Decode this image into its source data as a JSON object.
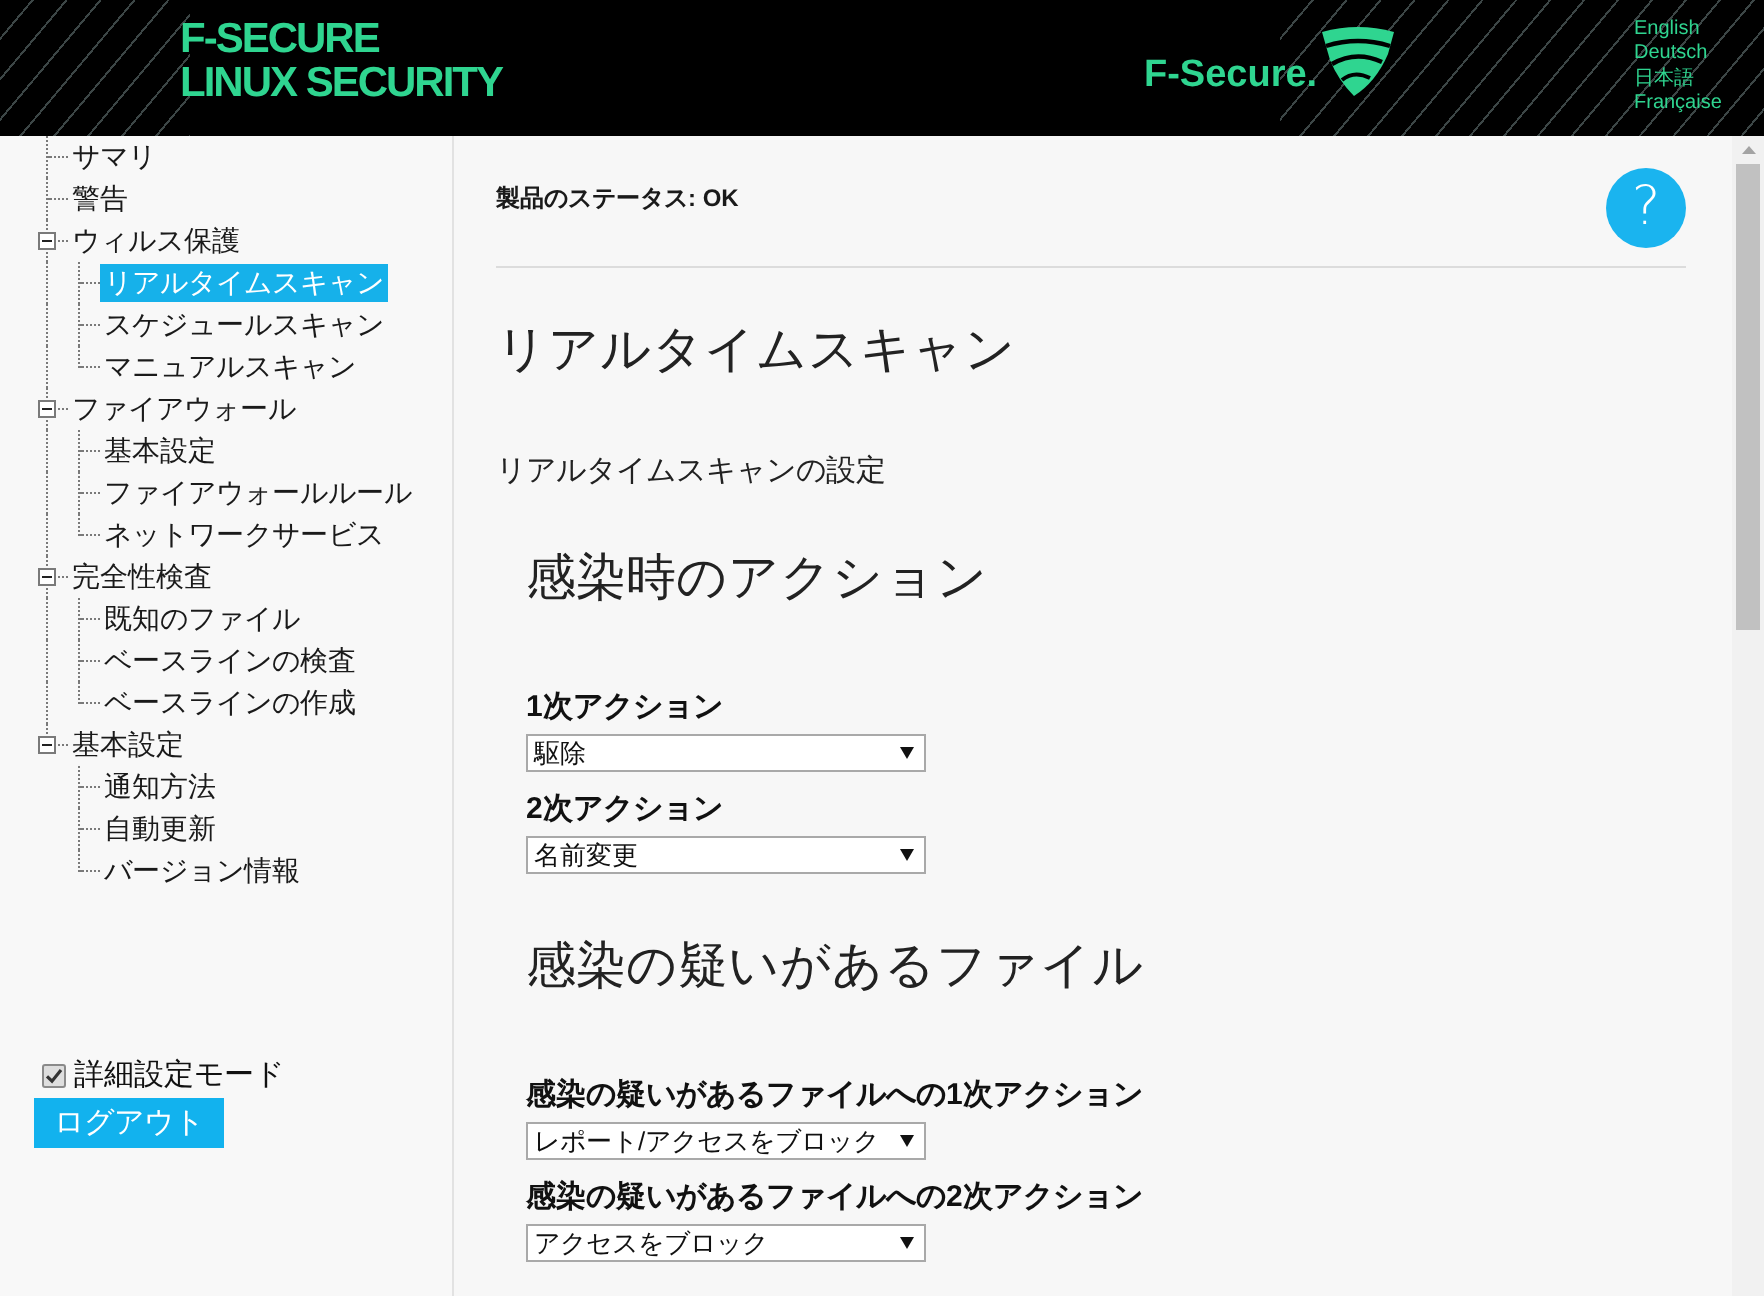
{
  "header": {
    "logo_lines": [
      "F-SECURE",
      "LINUX SECURITY"
    ],
    "brand": "F-Secure.",
    "languages": [
      "English",
      "Deutsch",
      "日本語",
      "Française"
    ]
  },
  "sidebar": {
    "tree": [
      {
        "label": "サマリ",
        "selected": false
      },
      {
        "label": "警告",
        "selected": false
      },
      {
        "label": "ウィルス保護",
        "selected": false,
        "expanded": true,
        "children": [
          {
            "label": "リアルタイムスキャン",
            "selected": true
          },
          {
            "label": "スケジュールスキャン",
            "selected": false
          },
          {
            "label": "マニュアルスキャン",
            "selected": false
          }
        ]
      },
      {
        "label": "ファイアウォール",
        "selected": false,
        "expanded": true,
        "children": [
          {
            "label": "基本設定",
            "selected": false
          },
          {
            "label": "ファイアウォールルール",
            "selected": false
          },
          {
            "label": "ネットワークサービス",
            "selected": false
          }
        ]
      },
      {
        "label": "完全性検査",
        "selected": false,
        "expanded": true,
        "children": [
          {
            "label": "既知のファイル",
            "selected": false
          },
          {
            "label": "ベースラインの検査",
            "selected": false
          },
          {
            "label": "ベースラインの作成",
            "selected": false
          }
        ]
      },
      {
        "label": "基本設定",
        "selected": false,
        "expanded": true,
        "children": [
          {
            "label": "通知方法",
            "selected": false
          },
          {
            "label": "自動更新",
            "selected": false
          },
          {
            "label": "バージョン情報",
            "selected": false
          }
        ]
      }
    ],
    "advanced_mode": {
      "label": "詳細設定モード",
      "checked": true
    },
    "logout_button": "ログアウト"
  },
  "main": {
    "status": "製品のステータス: OK",
    "help_button": "?",
    "title": "リアルタイムスキャン",
    "subtitle": "リアルタイムスキャンの設定",
    "sections": [
      {
        "heading": "感染時のアクション",
        "fields": [
          {
            "label": "1次アクション",
            "value": "駆除"
          },
          {
            "label": "2次アクション",
            "value": "名前変更"
          }
        ]
      },
      {
        "heading": "感染の疑いがあるファイル",
        "fields": [
          {
            "label": "感染の疑いがあるファイルへの1次アクション",
            "value": "レポート/アクセスをブロック"
          },
          {
            "label": "感染の疑いがあるファイルへの2次アクション",
            "value": "アクセスをブロック"
          }
        ]
      }
    ]
  }
}
